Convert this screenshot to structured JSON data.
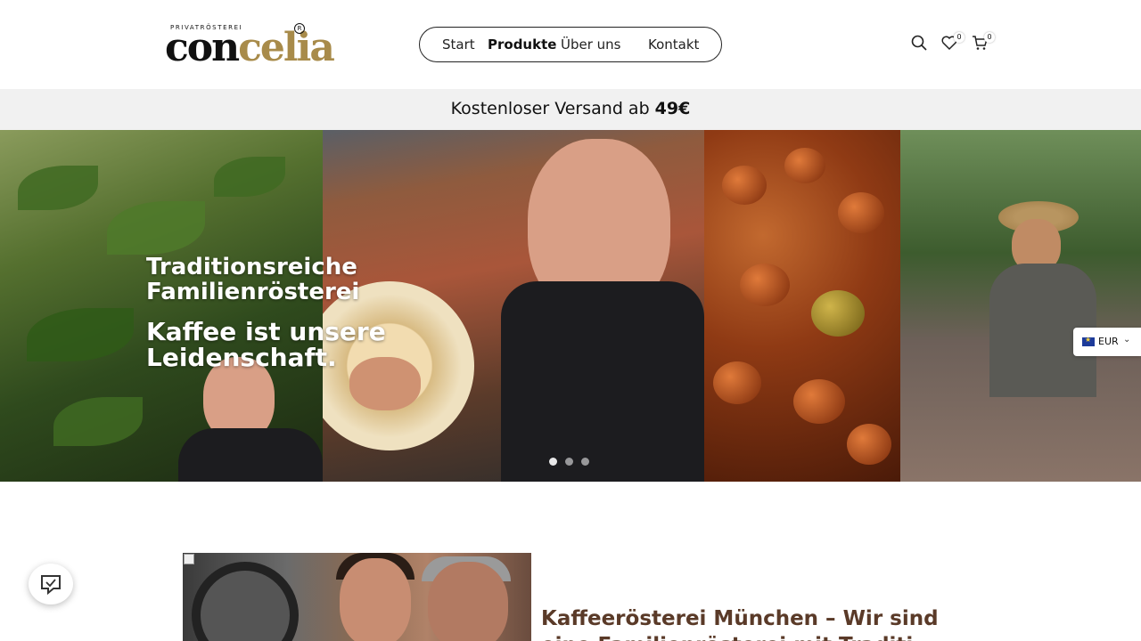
{
  "header": {
    "logo": {
      "tagline": "PRIVATRÖSTEREI",
      "word_a": "con",
      "word_b": "celia",
      "registered": "R"
    },
    "nav": [
      {
        "label": "Start",
        "active": false
      },
      {
        "label": "Produkte",
        "active": true
      },
      {
        "label": "Über uns",
        "active": false
      },
      {
        "label": "Kontakt",
        "active": false
      }
    ],
    "icons": {
      "search": "search-icon",
      "wishlist": "heart-icon",
      "cart": "cart-icon"
    },
    "wishlist_count": "0",
    "cart_count": "0"
  },
  "announcement": {
    "text": "Kostenloser Versand ab ",
    "amount": "49€"
  },
  "hero": {
    "line1": "Traditionsreiche",
    "line2": "Familienrösterei",
    "line3": "Kaffee ist unsere",
    "line4": "Leidenschaft.",
    "slides": 3,
    "active_slide": 1
  },
  "currency": {
    "code": "EUR",
    "flag": "eu-flag-icon"
  },
  "about": {
    "title_line1": "Kaffeerösterei München – Wir sind",
    "title_line2": "eine Familienrösterei mit Traditi"
  },
  "chat": {
    "icon": "chat-icon"
  },
  "colors": {
    "accent_gold": "#a88b4a",
    "title_brown": "#5a3a28",
    "announce_bg": "#f1f1f1"
  }
}
